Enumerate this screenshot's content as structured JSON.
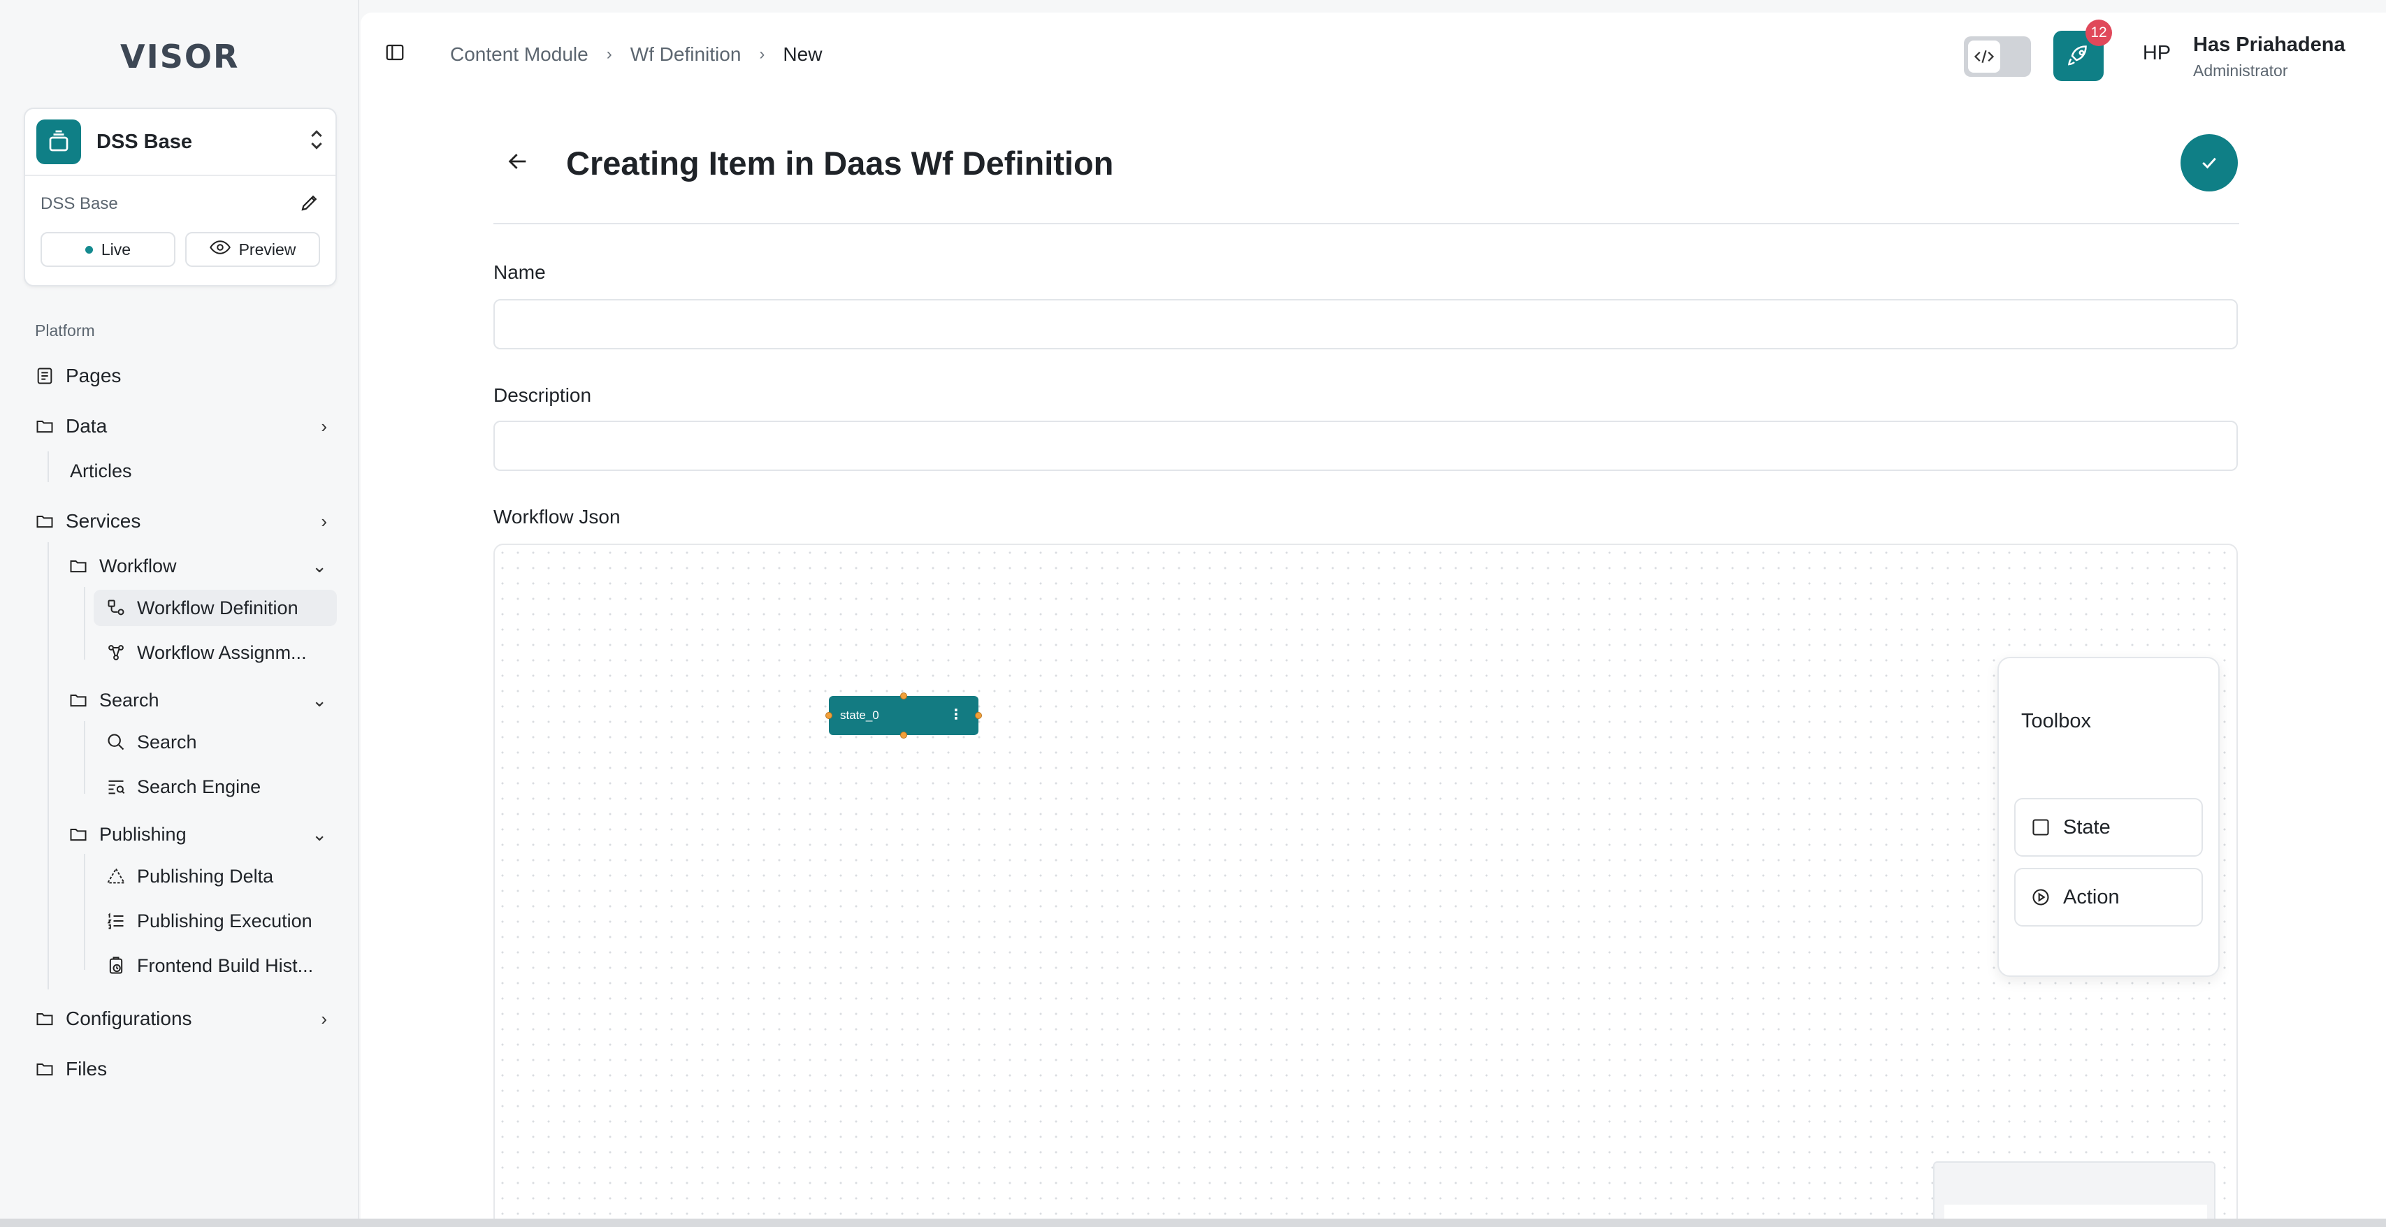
{
  "brand": {
    "logo": "VISOR"
  },
  "site": {
    "name": "DSS Base",
    "sub_label": "DSS Base",
    "live_label": "Live",
    "preview_label": "Preview"
  },
  "sidebar": {
    "section": "Platform",
    "pages": "Pages",
    "data": "Data",
    "articles": "Articles",
    "services": "Services",
    "workflow": "Workflow",
    "workflow_definition": "Workflow Definition",
    "workflow_assignment": "Workflow Assignm...",
    "search_group": "Search",
    "search": "Search",
    "search_engine": "Search Engine",
    "publishing": "Publishing",
    "publishing_delta": "Publishing Delta",
    "publishing_execution": "Publishing Execution",
    "frontend_build": "Frontend Build Hist...",
    "configurations": "Configurations",
    "files": "Files"
  },
  "breadcrumb": [
    "Content Module",
    "Wf Definition",
    "New"
  ],
  "header": {
    "badge_count": "12",
    "avatar_initials": "HP",
    "user_name": "Has Priahadena",
    "user_role": "Administrator"
  },
  "page": {
    "title": "Creating Item in Daas Wf Definition"
  },
  "form": {
    "name_label": "Name",
    "name_value": "",
    "description_label": "Description",
    "description_value": "",
    "workflow_label": "Workflow Json"
  },
  "workflow": {
    "node_label": "state_0",
    "toolbox_title": "Toolbox",
    "tools": [
      "State",
      "Action"
    ]
  },
  "colors": {
    "accent": "#0f7f86",
    "badge": "#e0485a",
    "handle": "#f2a03a"
  }
}
